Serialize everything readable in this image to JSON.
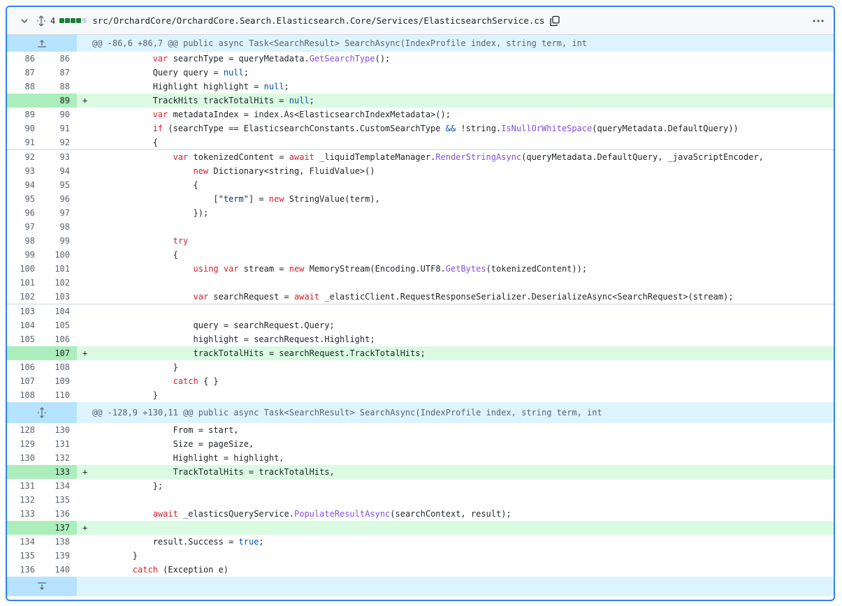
{
  "header": {
    "changes_count": "4",
    "file_path": "src/OrchardCore/OrchardCore.Search.Elasticsearch.Core/Services/ElasticsearchService.cs",
    "diffstat_colors": [
      "#1a7f37",
      "#1a7f37",
      "#1a7f37",
      "#1a7f37",
      "#d0d7de"
    ],
    "icons": [
      "chevron-down-icon",
      "expand-all-icon",
      "copy-icon",
      "kebab-menu-icon"
    ]
  },
  "hunks": {
    "h1": "@@ -86,6 +86,7 @@ public async Task<SearchResult> SearchAsync(IndexProfile index, string term, int",
    "h2": "@@ -128,9 +130,11 @@ public async Task<SearchResult> SearchAsync(IndexProfile index, string term, int"
  },
  "lines": [
    {
      "old": "86",
      "new": "86",
      "sign": "",
      "tokens": [
        {
          "t": "            "
        },
        {
          "t": "var",
          "c": "kw"
        },
        {
          "t": " searchType = queryMetadata."
        },
        {
          "t": "GetSearchType",
          "c": "fn"
        },
        {
          "t": "();"
        }
      ]
    },
    {
      "old": "87",
      "new": "87",
      "sign": "",
      "tokens": [
        {
          "t": "            Query query = "
        },
        {
          "t": "null",
          "c": "kb"
        },
        {
          "t": ";"
        }
      ]
    },
    {
      "old": "88",
      "new": "88",
      "sign": "",
      "tokens": [
        {
          "t": "            Highlight highlight = "
        },
        {
          "t": "null",
          "c": "kb"
        },
        {
          "t": ";"
        }
      ]
    },
    {
      "old": "",
      "new": "89",
      "sign": "+",
      "tokens": [
        {
          "t": "            TrackHits trackTotalHits = "
        },
        {
          "t": "null",
          "c": "kb"
        },
        {
          "t": ";"
        }
      ]
    },
    {
      "old": "89",
      "new": "90",
      "sign": "",
      "tokens": [
        {
          "t": "            "
        },
        {
          "t": "var",
          "c": "kw"
        },
        {
          "t": " metadataIndex = index.As<ElasticsearchIndexMetadata>();"
        }
      ]
    },
    {
      "old": "90",
      "new": "91",
      "sign": "",
      "tokens": [
        {
          "t": "            "
        },
        {
          "t": "if",
          "c": "kw"
        },
        {
          "t": " (searchType == ElasticsearchConstants.CustomSearchType "
        },
        {
          "t": "&&",
          "c": "kb"
        },
        {
          "t": " !string."
        },
        {
          "t": "IsNullOrWhiteSpace",
          "c": "fn"
        },
        {
          "t": "(queryMetadata.DefaultQuery))"
        }
      ]
    },
    {
      "old": "91",
      "new": "92",
      "sign": "",
      "tokens": [
        {
          "t": "            {"
        }
      ]
    },
    {
      "old": "92",
      "new": "93",
      "sign": "",
      "sep": true,
      "tokens": [
        {
          "t": "                "
        },
        {
          "t": "var",
          "c": "kw"
        },
        {
          "t": " tokenizedContent = "
        },
        {
          "t": "await",
          "c": "kw"
        },
        {
          "t": " _liquidTemplateManager."
        },
        {
          "t": "RenderStringAsync",
          "c": "fn"
        },
        {
          "t": "(queryMetadata.DefaultQuery, _javaScriptEncoder,"
        }
      ]
    },
    {
      "old": "93",
      "new": "94",
      "sign": "",
      "tokens": [
        {
          "t": "                    "
        },
        {
          "t": "new",
          "c": "kw"
        },
        {
          "t": " Dictionary<string, FluidValue>()"
        }
      ]
    },
    {
      "old": "94",
      "new": "95",
      "sign": "",
      "tokens": [
        {
          "t": "                    {"
        }
      ]
    },
    {
      "old": "95",
      "new": "96",
      "sign": "",
      "tokens": [
        {
          "t": "                        ["
        },
        {
          "t": "\"term\"",
          "c": "st"
        },
        {
          "t": "] = "
        },
        {
          "t": "new",
          "c": "kw"
        },
        {
          "t": " StringValue(term),"
        }
      ]
    },
    {
      "old": "96",
      "new": "97",
      "sign": "",
      "tokens": [
        {
          "t": "                    });"
        }
      ]
    },
    {
      "old": "97",
      "new": "98",
      "sign": "",
      "tokens": [
        {
          "t": ""
        }
      ]
    },
    {
      "old": "98",
      "new": "99",
      "sign": "",
      "tokens": [
        {
          "t": "                "
        },
        {
          "t": "try",
          "c": "kw"
        }
      ]
    },
    {
      "old": "99",
      "new": "100",
      "sign": "",
      "tokens": [
        {
          "t": "                {"
        }
      ]
    },
    {
      "old": "100",
      "new": "101",
      "sign": "",
      "tokens": [
        {
          "t": "                    "
        },
        {
          "t": "using",
          "c": "kw"
        },
        {
          "t": " "
        },
        {
          "t": "var",
          "c": "kw"
        },
        {
          "t": " stream = "
        },
        {
          "t": "new",
          "c": "kw"
        },
        {
          "t": " MemoryStream(Encoding.UTF8."
        },
        {
          "t": "GetBytes",
          "c": "fn"
        },
        {
          "t": "(tokenizedContent));"
        }
      ]
    },
    {
      "old": "101",
      "new": "102",
      "sign": "",
      "tokens": [
        {
          "t": ""
        }
      ]
    },
    {
      "old": "102",
      "new": "103",
      "sign": "",
      "tokens": [
        {
          "t": "                    "
        },
        {
          "t": "var",
          "c": "kw"
        },
        {
          "t": " searchRequest = "
        },
        {
          "t": "await",
          "c": "kw"
        },
        {
          "t": " _elasticClient.RequestResponseSerializer.DeserializeAsync<SearchRequest>(stream);"
        }
      ]
    },
    {
      "old": "103",
      "new": "104",
      "sign": "",
      "sep": true,
      "tokens": [
        {
          "t": ""
        }
      ]
    },
    {
      "old": "104",
      "new": "105",
      "sign": "",
      "tokens": [
        {
          "t": "                    query = searchRequest.Query;"
        }
      ]
    },
    {
      "old": "105",
      "new": "106",
      "sign": "",
      "tokens": [
        {
          "t": "                    highlight = searchRequest.Highlight;"
        }
      ]
    },
    {
      "old": "",
      "new": "107",
      "sign": "+",
      "tokens": [
        {
          "t": "                    trackTotalHits = searchRequest.TrackTotalHits;"
        }
      ]
    },
    {
      "old": "106",
      "new": "108",
      "sign": "",
      "tokens": [
        {
          "t": "                }"
        }
      ]
    },
    {
      "old": "107",
      "new": "109",
      "sign": "",
      "tokens": [
        {
          "t": "                "
        },
        {
          "t": "catch",
          "c": "kw"
        },
        {
          "t": " { }"
        }
      ]
    },
    {
      "old": "108",
      "new": "110",
      "sign": "",
      "tokens": [
        {
          "t": "            }"
        }
      ]
    },
    {
      "hunk": "h2"
    },
    {
      "old": "128",
      "new": "130",
      "sign": "",
      "tokens": [
        {
          "t": "                From = start,"
        }
      ]
    },
    {
      "old": "129",
      "new": "131",
      "sign": "",
      "tokens": [
        {
          "t": "                Size = pageSize,"
        }
      ]
    },
    {
      "old": "130",
      "new": "132",
      "sign": "",
      "tokens": [
        {
          "t": "                Highlight = highlight,"
        }
      ]
    },
    {
      "old": "",
      "new": "133",
      "sign": "+",
      "tokens": [
        {
          "t": "                TrackTotalHits = trackTotalHits,"
        }
      ]
    },
    {
      "old": "131",
      "new": "134",
      "sign": "",
      "tokens": [
        {
          "t": "            };"
        }
      ]
    },
    {
      "old": "132",
      "new": "135",
      "sign": "",
      "tokens": [
        {
          "t": ""
        }
      ]
    },
    {
      "old": "133",
      "new": "136",
      "sign": "",
      "tokens": [
        {
          "t": "            "
        },
        {
          "t": "await",
          "c": "kw"
        },
        {
          "t": " _elasticsQueryService."
        },
        {
          "t": "PopulateResultAsync",
          "c": "fn"
        },
        {
          "t": "(searchContext, result);"
        }
      ]
    },
    {
      "old": "",
      "new": "137",
      "sign": "+",
      "tokens": [
        {
          "t": ""
        }
      ]
    },
    {
      "old": "134",
      "new": "138",
      "sign": "",
      "tokens": [
        {
          "t": "            result.Success = "
        },
        {
          "t": "true",
          "c": "kb"
        },
        {
          "t": ";"
        }
      ]
    },
    {
      "old": "135",
      "new": "139",
      "sign": "",
      "tokens": [
        {
          "t": "        }"
        }
      ]
    },
    {
      "old": "136",
      "new": "140",
      "sign": "",
      "tokens": [
        {
          "t": "        "
        },
        {
          "t": "catch",
          "c": "kw"
        },
        {
          "t": " (Exception e)"
        }
      ]
    }
  ]
}
